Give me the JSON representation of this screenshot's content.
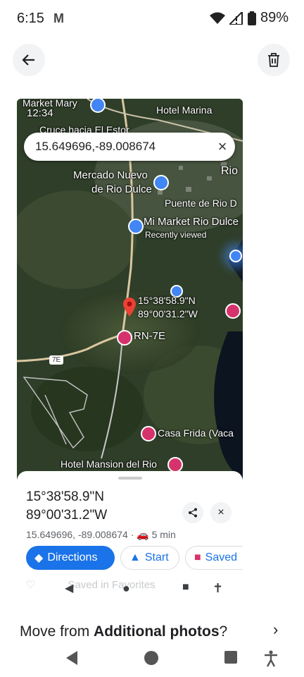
{
  "status_bar": {
    "time": "6:15",
    "battery": "89%"
  },
  "map": {
    "time": "12:34",
    "labels": {
      "market_mary": "Market Mary",
      "hotel_marina": "Hotel Marina",
      "cruce": "Cruce hacia El Estor",
      "rio": "Rio",
      "mercado_1": "Mercado Nuevo",
      "mercado_2": "de Rio Dulce",
      "puente": "Puente de Rio D",
      "mi_market": "Mi Market Rio Dulce",
      "recently_viewed": "Recently viewed",
      "pin_lat": "15°38'58.9\"N",
      "pin_lon": "89°00'31.2\"W",
      "rn7e": "RN-7E",
      "road_7e": "7E",
      "casa_frida": "Casa Frida (Vaca",
      "hotel_mansion": "Hotel Mansion del Rio"
    },
    "search_value": "15.649696,-89.008674"
  },
  "place": {
    "title": "15°38'58.9\"N 89°00'31.2\"W",
    "coords": "15.649696, -89.008674",
    "travel_time": "5 min"
  },
  "chips": {
    "directions": "Directions",
    "start": "Start",
    "saved": "Saved"
  },
  "saved_in": "Saved in Favorites",
  "prompt": {
    "prefix": "Move from ",
    "bold": "Additional photos",
    "suffix": "?"
  },
  "colors": {
    "accent": "#1a73e8",
    "pin": "#ea4335",
    "saved_pink": "#d6336c"
  }
}
